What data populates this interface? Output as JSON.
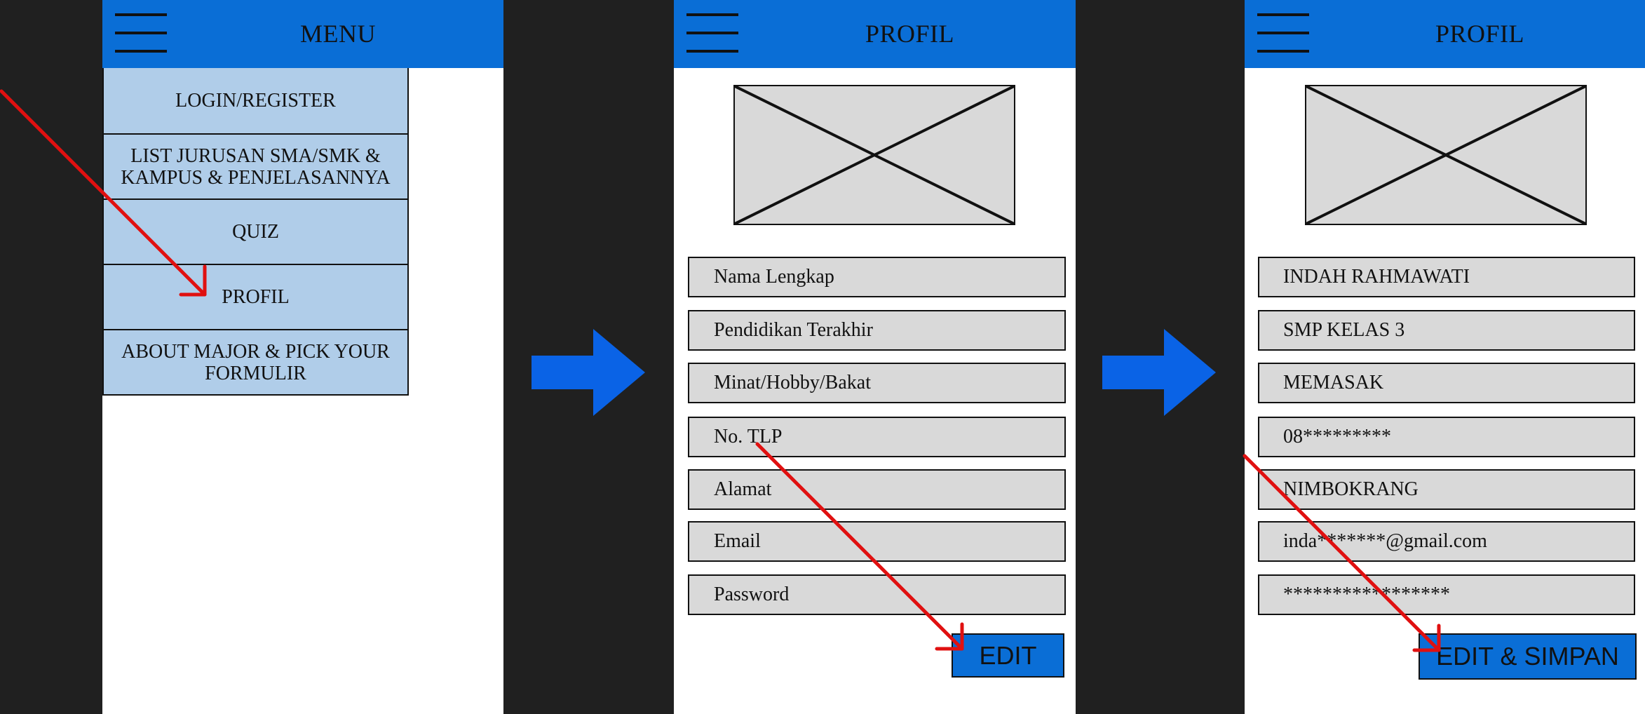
{
  "colors": {
    "background": "#202020",
    "header": "#0a6ed6",
    "menu_item": "#b0cde9",
    "field": "#d9d9d9",
    "button": "#0a6ed6",
    "flow_arrow": "#0a63e6",
    "annotation_arrow": "#e01010"
  },
  "screen1": {
    "header": {
      "title": "MENU",
      "menu_icon": "hamburger-icon"
    },
    "menu_items": [
      {
        "label": "LOGIN/REGISTER"
      },
      {
        "label": "LIST JURUSAN SMA/SMK & KAMPUS & PENJELASANNYA"
      },
      {
        "label": "QUIZ"
      },
      {
        "label": "PROFIL"
      },
      {
        "label": "ABOUT MAJOR & PICK YOUR FORMULIR"
      }
    ]
  },
  "screen2": {
    "header": {
      "title": "PROFIL",
      "menu_icon": "hamburger-icon"
    },
    "photo_icon": "image-placeholder-icon",
    "fields": [
      {
        "placeholder": "Nama Lengkap"
      },
      {
        "placeholder": "Pendidikan Terakhir"
      },
      {
        "placeholder": "Minat/Hobby/Bakat"
      },
      {
        "placeholder": "No. TLP"
      },
      {
        "placeholder": "Alamat"
      },
      {
        "placeholder": "Email"
      },
      {
        "placeholder": "Password"
      }
    ],
    "button_label": "EDIT"
  },
  "screen3": {
    "header": {
      "title": "PROFIL",
      "menu_icon": "hamburger-icon"
    },
    "photo_icon": "image-placeholder-icon",
    "fields": [
      {
        "value": "INDAH RAHMAWATI"
      },
      {
        "value": "SMP KELAS 3"
      },
      {
        "value": "MEMASAK"
      },
      {
        "value": "08*********"
      },
      {
        "value": "NIMBOKRANG"
      },
      {
        "value": "inda*******@gmail.com"
      },
      {
        "value": "*****************"
      }
    ],
    "button_label": "EDIT & SIMPAN"
  },
  "flow_arrows": [
    "right-arrow-icon",
    "right-arrow-icon"
  ]
}
